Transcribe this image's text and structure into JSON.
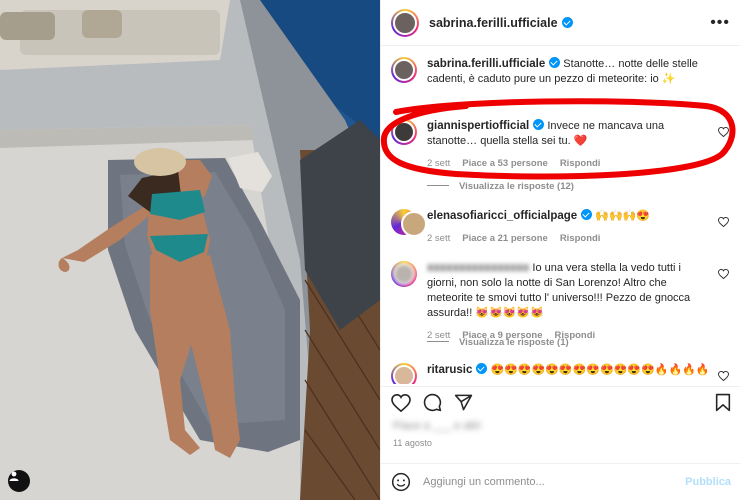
{
  "post": {
    "author": "sabrina.ferilli.ufficiale",
    "more_icon": "more-horizontal-icon"
  },
  "caption": {
    "username": "sabrina.ferilli.ufficiale",
    "text": "Stanotte… notte delle stelle cadenti, è caduto pure un pezzo di meteorite: io ✨"
  },
  "comments": [
    {
      "username": "giannispertiofficial",
      "text": "Invece ne mancava una stanotte… quella stella sei tu. ❤️",
      "time": "2 sett",
      "likes": "Piace a 53 persone",
      "reply": "Rispondi",
      "view_replies": "Visualizza le risposte (12)"
    },
    {
      "username": "elenasofiaricci_officialpage",
      "text": "🙌🙌🙌😍",
      "time": "2 sett",
      "likes": "Piace a 21 persone",
      "reply": "Rispondi"
    },
    {
      "username": "",
      "text_lead": "Io una vera stella la vedo tutti i giorni, non solo la notte di San Lorenzo! Altro che meteorite te smovi tutto l' universo!!! Pezzo de gnocca assurda!! 😻😻😻😻😻",
      "time": "2 sett",
      "likes": "Piace a 9 persone",
      "reply": "Rispondi",
      "view_replies": "Visualizza le risposte (1)"
    },
    {
      "username": "ritarusic",
      "text": "😍😍😍😍😍😍😍😍😍😍😍😍🔥🔥🔥🔥"
    }
  ],
  "likes_line": "Piace a ___ e altri",
  "date_line": "11 agosto",
  "add_comment": {
    "placeholder": "Aggiungi un commento...",
    "post_label": "Pubblica"
  },
  "colors": {
    "accent": "#0095f6",
    "highlight_loop": "#ee0000",
    "heart_red": "#ed4956"
  }
}
